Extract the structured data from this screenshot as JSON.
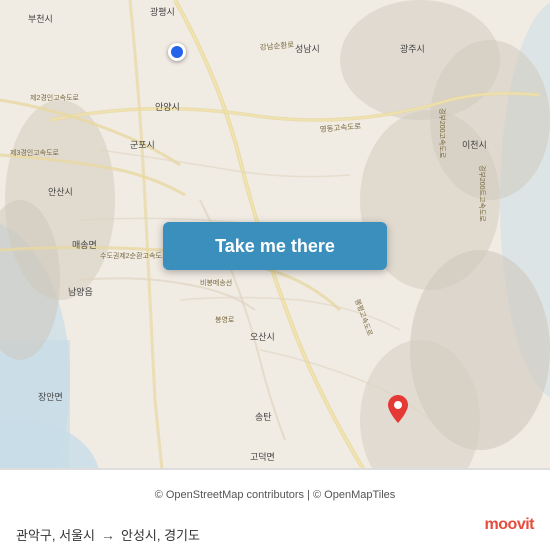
{
  "map": {
    "background_color": "#f0ebe3",
    "attribution": "© OpenStreetMap contributors | © OpenMapTiles",
    "origin_label": "관악구, 서울시",
    "destination_label": "안성시, 경기도",
    "arrow_symbol": "→"
  },
  "button": {
    "label": "Take me there"
  },
  "footer": {
    "origin": "관악구, 서울시",
    "destination": "안성시, 경기도",
    "arrow": "→",
    "moovit": "moovit"
  },
  "icons": {
    "origin_marker": "blue-circle-marker",
    "destination_marker": "red-teardrop-marker"
  }
}
